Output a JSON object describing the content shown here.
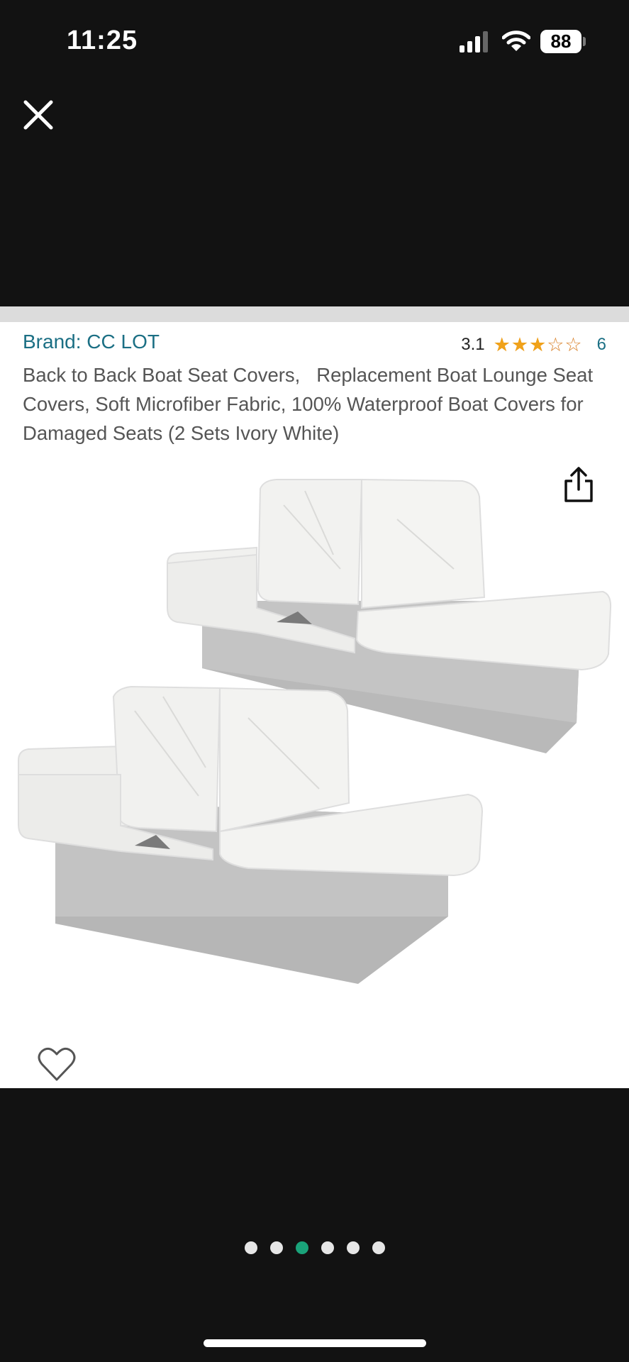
{
  "status_bar": {
    "time": "11:25",
    "battery": "88",
    "signal_icon": "cellular-signal-icon",
    "wifi_icon": "wifi-icon"
  },
  "header": {
    "close_icon": "close-icon"
  },
  "product": {
    "brand": "Brand: CC LOT",
    "rating_value": "3.1",
    "rating_count": "6",
    "rating_fraction": 0.62,
    "title": "Back to Back Boat Seat Covers,   Replacement Boat Lounge Seat Covers, Soft Microfiber Fabric, 100% Waterproof Boat Covers for Damaged Seats (2 Sets Ivory White)",
    "share_icon": "share-icon",
    "favorite_icon": "heart-icon",
    "image_subject": "two-boat-lounge-seats"
  },
  "carousel": {
    "total": 6,
    "active_index": 2
  },
  "colors": {
    "background": "#121212",
    "brand_link": "#1b6f84",
    "star": "#f0a21a",
    "active_dot": "#1aa37a",
    "inactive_dot": "#e6e6e6"
  }
}
